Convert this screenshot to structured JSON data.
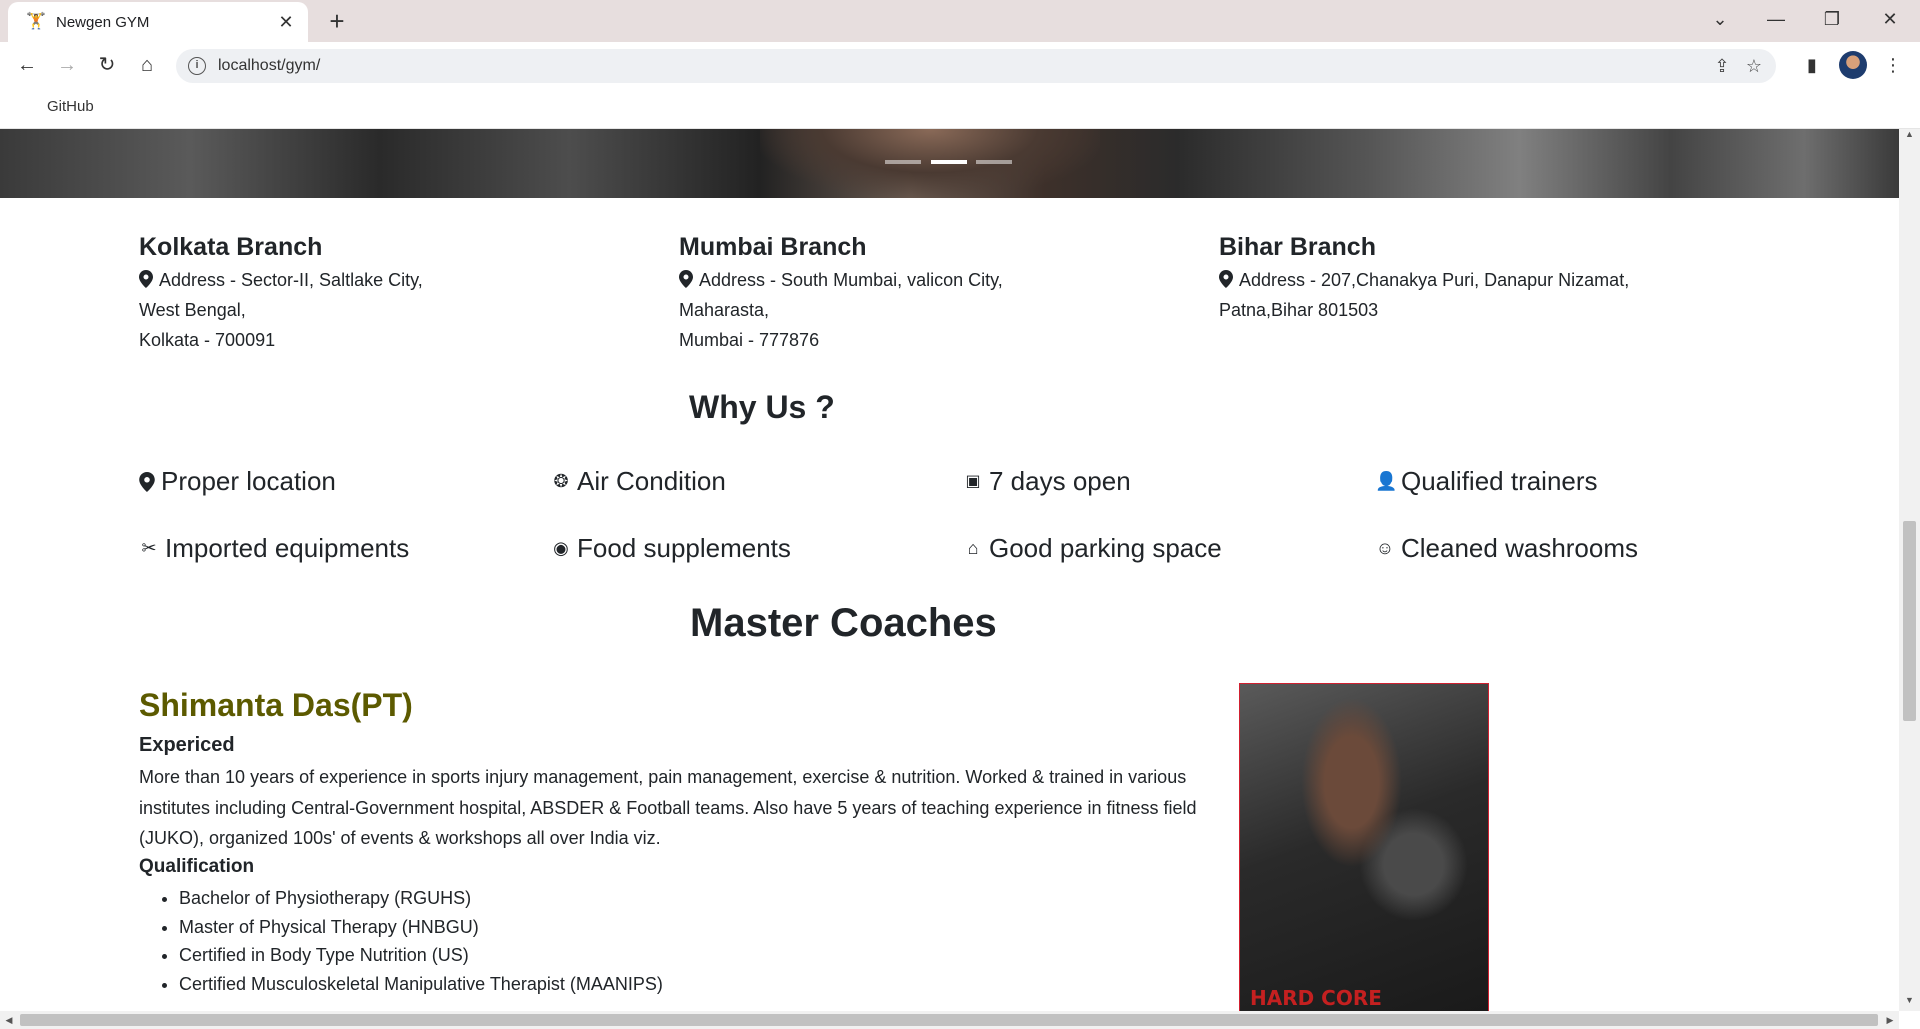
{
  "browser": {
    "tab_title": "Newgen GYM",
    "url": "localhost/gym/",
    "bookmark": "GitHub"
  },
  "branches": [
    {
      "name": "Kolkata Branch",
      "address_lines": [
        "Address - Sector-II, Saltlake City,",
        "West Bengal,",
        "Kolkata - 700091"
      ]
    },
    {
      "name": "Mumbai Branch",
      "address_lines": [
        "Address - South Mumbai, valicon City,",
        "Maharasta,",
        "Mumbai - 777876"
      ]
    },
    {
      "name": "Bihar Branch",
      "address_lines": [
        "Address - 207,Chanakya Puri, Danapur Nizamat,",
        "Patna,Bihar 801503",
        ""
      ]
    }
  ],
  "why_us": {
    "title": "Why Us ?",
    "features": [
      {
        "label": "Proper location",
        "icon": "location-icon"
      },
      {
        "label": "Air Condition",
        "icon": "fan-icon"
      },
      {
        "label": "7 days open",
        "icon": "calendar-icon"
      },
      {
        "label": "Qualified trainers",
        "icon": "trainer-icon"
      },
      {
        "label": "Imported equipments",
        "icon": "tools-icon"
      },
      {
        "label": "Food supplements",
        "icon": "supplement-icon"
      },
      {
        "label": "Good parking space",
        "icon": "home-icon"
      },
      {
        "label": "Cleaned washrooms",
        "icon": "smile-icon"
      }
    ]
  },
  "coaches": {
    "title": "Master Coaches",
    "coach": {
      "name": "Shimanta Das(PT)",
      "experience_heading": "Expericed",
      "bio": "More than 10 years of experience in sports injury management, pain management, exercise & nutrition. Worked & trained in various institutes including Central-Government hospital, ABSDER & Football teams. Also have 5 years of teaching experience in fitness field (JUKO), organized 100s' of events & workshops all over India viz.",
      "qualification_heading": "Qualification",
      "qualifications": [
        "Bachelor of Physiotherapy (RGUHS)",
        "Master of Physical Therapy (HNBGU)",
        "Certified in Body Type Nutrition (US)",
        "Certified Musculoskeletal Manipulative Therapist (MAANIPS)"
      ],
      "photo_text": "HARD CORE"
    }
  }
}
